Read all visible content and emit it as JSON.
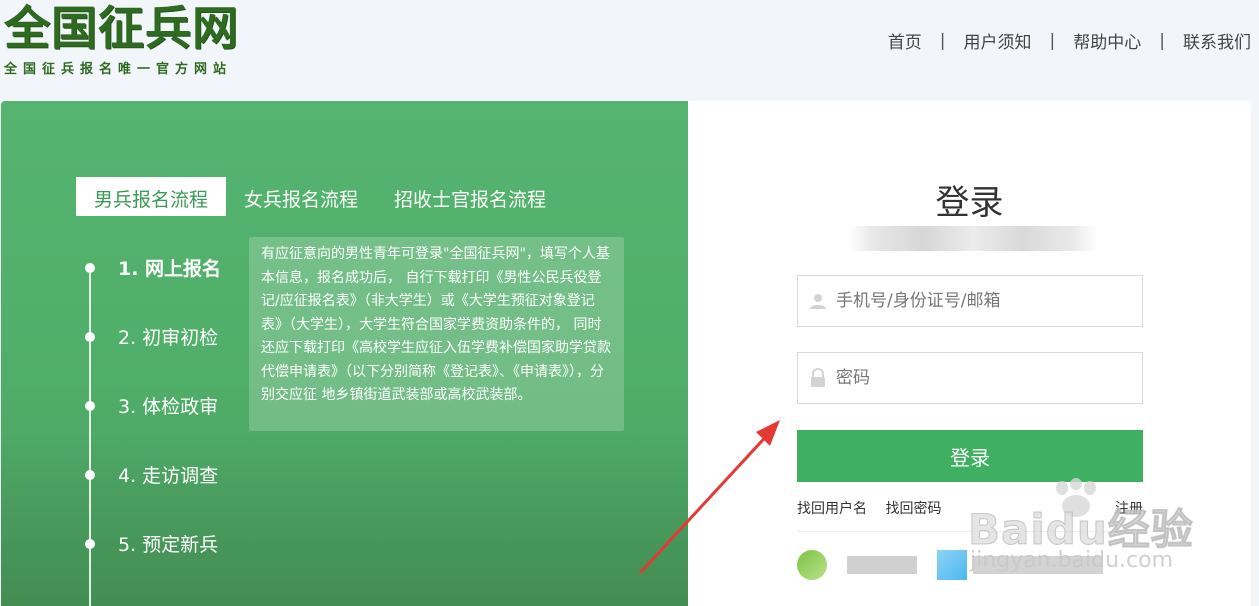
{
  "logo": {
    "title": "全国征兵网",
    "subtitle": "全国征兵报名唯一官方网站"
  },
  "nav": {
    "items": [
      "首页",
      "用户须知",
      "帮助中心",
      "联系我们"
    ],
    "separator": "|"
  },
  "tabs": [
    {
      "label": "男兵报名流程",
      "active": true
    },
    {
      "label": "女兵报名流程",
      "active": false
    },
    {
      "label": "招收士官报名流程",
      "active": false
    }
  ],
  "steps": [
    {
      "label": "1. 网上报名",
      "active": true
    },
    {
      "label": "2. 初审初检",
      "active": false
    },
    {
      "label": "3. 体检政审",
      "active": false
    },
    {
      "label": "4. 走访调查",
      "active": false
    },
    {
      "label": "5. 预定新兵",
      "active": false
    }
  ],
  "tooltip": "有应征意向的男性青年可登录\"全国征兵网\"，填写个人基本信息，报名成功后， 自行下载打印《男性公民兵役登记/应征报名表》（非大学生）或《大学生预征对象登记表》（大学生），大学生符合国家学费资助条件的， 同时还应下载打印《高校学生应征入伍学费补偿国家助学贷款代偿申请表》（以下分别简称《登记表》、《申请表》），分别交应征 地乡镇街道武装部或高校武装部。",
  "login": {
    "title": "登录",
    "username_placeholder": "手机号/身份证号/邮箱",
    "password_placeholder": "密码",
    "button": "登录",
    "find_username": "找回用户名",
    "find_password": "找回密码",
    "register": "注册"
  },
  "watermark": {
    "brand": "Baidu经验",
    "url": "jingyan.baidu.com"
  },
  "colors": {
    "brand_green": "#3fb062",
    "panel_green": "#52b16c",
    "logo_green": "#2e6a1f",
    "arrow_red": "#e53935"
  }
}
